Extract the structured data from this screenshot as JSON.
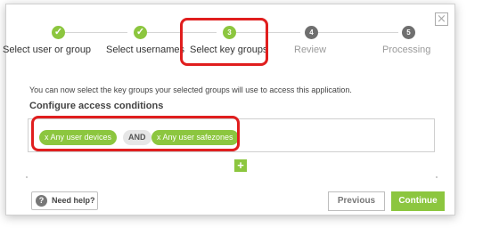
{
  "wizard": {
    "steps": [
      {
        "label": "Select user or group",
        "marker": "✓",
        "state": "done"
      },
      {
        "label": "Select usernames",
        "marker": "✓",
        "state": "done"
      },
      {
        "label": "Select key groups",
        "marker": "3",
        "state": "active"
      },
      {
        "label": "Review",
        "marker": "4",
        "state": "pending"
      },
      {
        "label": "Processing",
        "marker": "5",
        "state": "pending"
      }
    ],
    "close_glyph": "×"
  },
  "content": {
    "info_text": "You can now select the key groups your selected groups will use to access this application.",
    "section_title": "Configure access conditions",
    "conditions": [
      {
        "label": "x Any user devices",
        "kind": "item"
      },
      {
        "label": "AND",
        "kind": "operator"
      },
      {
        "label": "x Any user safezones",
        "kind": "item"
      }
    ],
    "add_glyph": "+"
  },
  "footer": {
    "help_icon": "?",
    "help_label": "Need help?",
    "previous_label": "Previous",
    "continue_label": "Continue"
  },
  "colors": {
    "accent": "#8cc63f",
    "highlight": "#e01e1e",
    "pending": "#6f6f6f"
  }
}
